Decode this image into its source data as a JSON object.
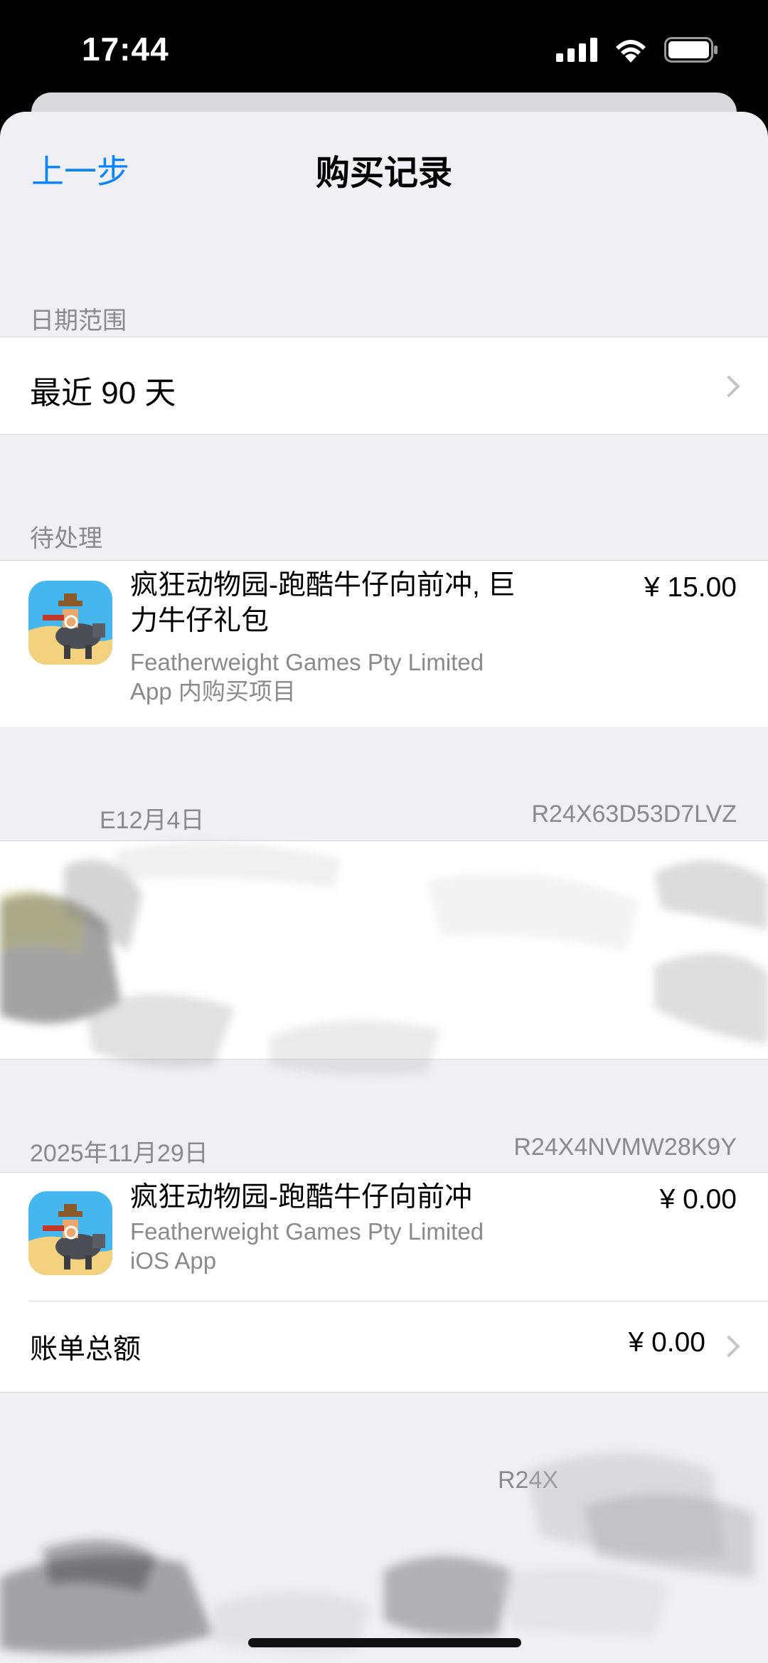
{
  "status_bar": {
    "time": "17:44"
  },
  "nav": {
    "back_label": "上一步",
    "title": "购买记录"
  },
  "date_range": {
    "header": "日期范围",
    "value": "最近 90 天"
  },
  "pending": {
    "header": "待处理",
    "item": {
      "title": "疯狂动物园-跑酷牛仔向前冲, 巨力牛仔礼包",
      "developer": "Featherweight Games Pty Limited",
      "kind": "App 内购买项目",
      "price": "¥ 15.00"
    }
  },
  "order_dec": {
    "date_partial": "E12月4日",
    "order_id": "R24X63D53D7LVZ"
  },
  "order_nov": {
    "date": "2025年11月29日",
    "order_id": "R24X4NVMW28K9Y",
    "item": {
      "title": "疯狂动物园-跑酷牛仔向前冲",
      "developer": "Featherweight Games Pty Limited",
      "kind": "iOS App",
      "price": "¥ 0.00"
    },
    "total_label": "账单总额",
    "total_value": "¥ 0.00"
  },
  "order_partial": {
    "order_id_partial": "R24X"
  },
  "colors": {
    "accent": "#0a84ff",
    "background": "#efeff4",
    "secondary_text": "#8a8a8e"
  }
}
